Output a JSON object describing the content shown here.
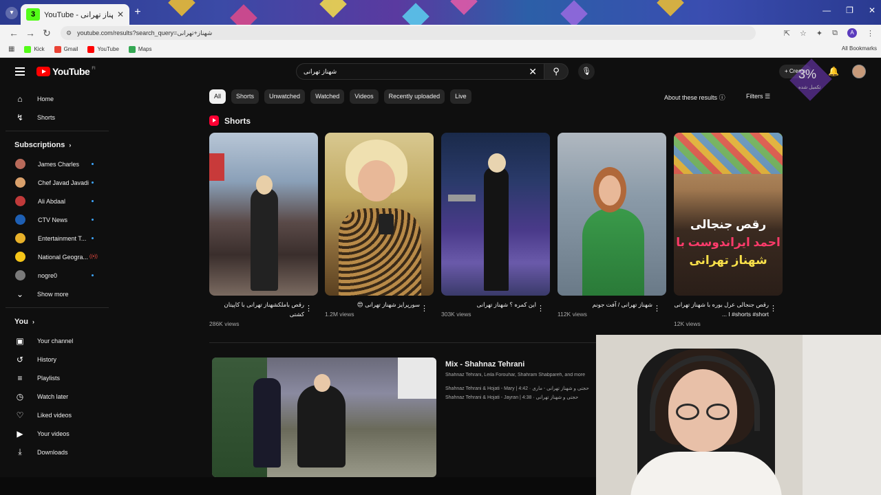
{
  "browser": {
    "tab_title": "YouTube - شهناز تهرانی",
    "tab_badge": "3",
    "url": "youtube.com/results?search_query=شهناز+تهرانی",
    "bookmarks": [
      {
        "label": "Kick",
        "color": "#53fc18"
      },
      {
        "label": "Gmail",
        "color": "#ea4335"
      },
      {
        "label": "YouTube",
        "color": "#ff0000"
      },
      {
        "label": "Maps",
        "color": "#34a853"
      }
    ],
    "all_bookmarks": "All Bookmarks",
    "profile_initial": "A"
  },
  "header": {
    "logo_text": "YouTube",
    "logo_region": "FI",
    "search_query": "شهناز تهرانی",
    "create_label": "Create"
  },
  "overlay": {
    "percent": "3%",
    "sub": "تکمیل شده"
  },
  "sidebar": {
    "main": [
      {
        "label": "Home",
        "icon": "home-icon",
        "glyph": "⌂"
      },
      {
        "label": "Shorts",
        "icon": "shorts-icon",
        "glyph": "↯"
      }
    ],
    "subscriptions_title": "Subscriptions",
    "subscriptions": [
      {
        "label": "James Charles",
        "color": "#b86a5a",
        "status": "dot"
      },
      {
        "label": "Chef Javad Javadi",
        "color": "#d9a06b",
        "status": "dot"
      },
      {
        "label": "Ali Abdaal",
        "color": "#c03a3a",
        "status": "dot"
      },
      {
        "label": "CTV News",
        "color": "#1e5fb3",
        "status": "dot"
      },
      {
        "label": "Entertainment T...",
        "color": "#e8b12a",
        "status": "dot"
      },
      {
        "label": "National Geogra...",
        "color": "#f5c518",
        "status": "live"
      },
      {
        "label": "nogre0",
        "color": "#7a7a7a",
        "status": "dot"
      }
    ],
    "show_more": "Show more",
    "you_title": "You",
    "you_items": [
      {
        "label": "Your channel",
        "glyph": "▣",
        "icon": "your-channel-icon"
      },
      {
        "label": "History",
        "glyph": "↺",
        "icon": "history-icon"
      },
      {
        "label": "Playlists",
        "glyph": "≡",
        "icon": "playlists-icon"
      },
      {
        "label": "Watch later",
        "glyph": "◷",
        "icon": "watch-later-icon"
      },
      {
        "label": "Liked videos",
        "glyph": "👍",
        "icon": "liked-icon"
      },
      {
        "label": "Your videos",
        "glyph": "▶",
        "icon": "your-videos-icon"
      },
      {
        "label": "Downloads",
        "glyph": "⤓",
        "icon": "downloads-icon"
      }
    ]
  },
  "chips": [
    "All",
    "Shorts",
    "Unwatched",
    "Watched",
    "Videos",
    "Recently uploaded",
    "Live"
  ],
  "about_label": "About these results",
  "filters_label": "Filters",
  "shorts_title": "Shorts",
  "shorts": [
    {
      "title": "رقص باملکشهناز تهرانی با کاپیتان کشتی",
      "views": "286K views"
    },
    {
      "title": "سورپرایز شهناز تهرانی 😍",
      "views": "1.2M views"
    },
    {
      "title": "این کمره ؟ شهناز تهرانی",
      "views": "303K views"
    },
    {
      "title": "شهناز تهرانی / آفت جونم",
      "views": "112K views"
    },
    {
      "title": "رقص جنجالی عرل بوره با شهناز تهرانی I #shorts #short ...",
      "views": "12K views",
      "overlay_lines": [
        "رقص جنجالی",
        "احمد ایراندوست با",
        "شهناز تهرانی"
      ]
    }
  ],
  "mix": {
    "title": "Mix - Shahnaz Tehrani",
    "subtitle": "Shahnaz Tehrani, Leila Forouhar, Shahram Shabpareh, and more",
    "tracks": [
      "Shahnaz Tehrani & Hojati - Mary | 4:42 · حجتی و شهناز تهرانی - ماری",
      "Shahnaz Tehrani & Hojati - Jayran | 4:38 · حجتی و شهناز تهرانی"
    ]
  }
}
